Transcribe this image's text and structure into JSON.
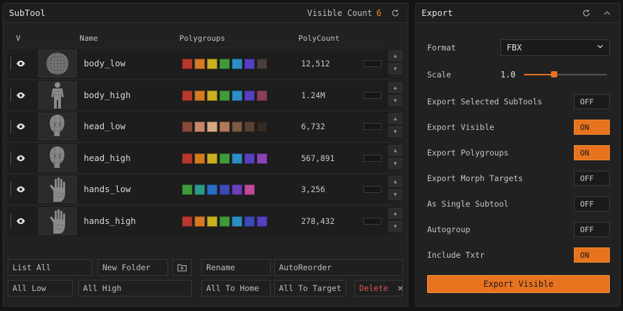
{
  "subtool": {
    "title": "SubTool",
    "visible_count_label": "Visible Count",
    "visible_count": "6",
    "columns": {
      "v": "V",
      "name": "Name",
      "polygroups": "Polygroups",
      "polycount": "PolyCount"
    },
    "rows": [
      {
        "name": "body_low",
        "polycount": "12,512",
        "icon": "sphere-mesh-icon",
        "colors": [
          "#b8392e",
          "#d67a22",
          "#c8b020",
          "#3f9a3a",
          "#2a8fc4",
          "#5540c0",
          "#4a3f3b"
        ]
      },
      {
        "name": "body_high",
        "polycount": "1.24M",
        "icon": "body-mesh-icon",
        "colors": [
          "#b8392e",
          "#d67a22",
          "#c8b020",
          "#3f9a3a",
          "#2a8fc4",
          "#5540c0",
          "#8a3f55"
        ]
      },
      {
        "name": "head_low",
        "polycount": "6,732",
        "icon": "head-mesh-icon",
        "colors": [
          "#8a4a3a",
          "#c8866a",
          "#d6a882",
          "#b07a58",
          "#7a5a40",
          "#5a4030",
          "#352a22"
        ]
      },
      {
        "name": "head_high",
        "polycount": "567,891",
        "icon": "head-mesh-icon",
        "colors": [
          "#b8392e",
          "#d67a22",
          "#c8b020",
          "#3f9a3a",
          "#2a8fc4",
          "#5540c0",
          "#8a44b8"
        ]
      },
      {
        "name": "hands_low",
        "polycount": "3,256",
        "icon": "hand-mesh-icon",
        "colors": [
          "#3f9a3a",
          "#2a9a8a",
          "#2a6ec4",
          "#3a4ab8",
          "#6a40c0",
          "#c04a9a"
        ]
      },
      {
        "name": "hands_high",
        "polycount": "278,432",
        "icon": "hand-mesh-icon",
        "colors": [
          "#b8392e",
          "#d67a22",
          "#c8b020",
          "#3f9a3a",
          "#2a8fc4",
          "#3a4ab8",
          "#5540c0"
        ]
      }
    ],
    "buttons": {
      "list_all": "List All",
      "new_folder": "New Folder",
      "rename": "Rename",
      "auto_reorder": "AutoReorder",
      "all_low": "All Low",
      "all_high": "All High",
      "all_to_home": "All To Home",
      "all_to_target": "All To Target",
      "delete": "Delete"
    }
  },
  "export": {
    "title": "Export",
    "format_label": "Format",
    "format_value": "FBX",
    "scale_label": "Scale",
    "scale_value": "1.0",
    "scale_fraction": 0.36,
    "options": [
      {
        "label": "Export Selected SubTools",
        "state": "OFF"
      },
      {
        "label": "Export Visible",
        "state": "ON"
      },
      {
        "label": "Export Polygroups",
        "state": "ON"
      },
      {
        "label": "Export Morph Targets",
        "state": "OFF"
      },
      {
        "label": "As Single Subtool",
        "state": "OFF"
      },
      {
        "label": "Autogroup",
        "state": "OFF"
      },
      {
        "label": "Include Txtr",
        "state": "ON"
      }
    ],
    "action_label": "Export Visible"
  },
  "colors": {
    "accent": "#e8731e",
    "delete": "#e05555"
  }
}
